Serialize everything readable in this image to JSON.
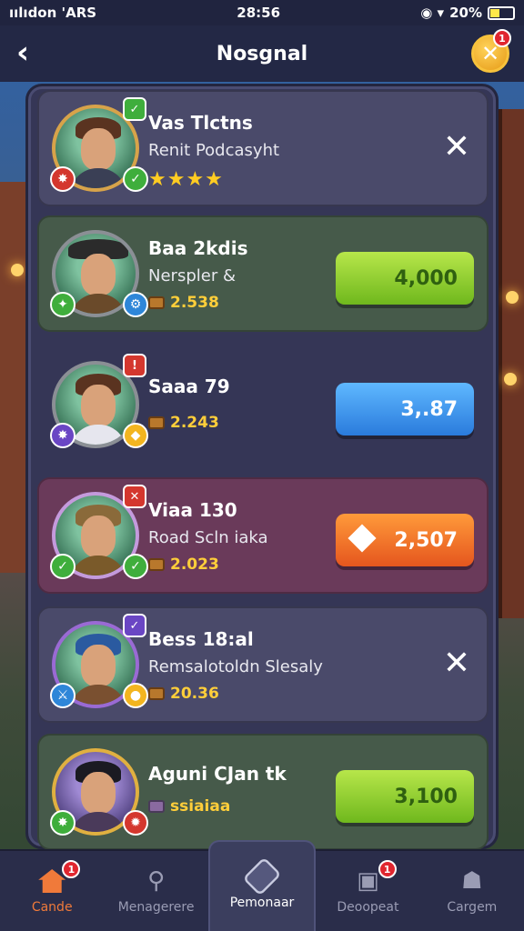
{
  "status_bar": {
    "carrier": "ıılıdon 'ARS",
    "time": "28:56",
    "battery": "20%"
  },
  "header": {
    "title": "Nosgnal",
    "back_glyph": "‹",
    "close_glyph": "✕",
    "close_badge": "1"
  },
  "cards": [
    {
      "name": "Vas Tlctns",
      "subtitle": "Renit Podcasyht",
      "stars": "★★★★",
      "action_type": "dismiss",
      "dismiss_glyph": "✕",
      "style": "gray"
    },
    {
      "name": "Baa 2kdis",
      "subtitle": "Nerspler &",
      "score": "2.538",
      "action_label": "4,000",
      "action_color": "green",
      "style": "green"
    },
    {
      "name": "Saaa 79",
      "subtitle": "",
      "score": "2.243",
      "action_label": "3,.87",
      "action_color": "blue",
      "style": "plain"
    },
    {
      "name": "Viaa 130",
      "subtitle": "Road Scln iaka",
      "score": "2.023",
      "action_label": "2,507",
      "action_color": "orange",
      "style": "pink"
    },
    {
      "name": "Bess 18:al",
      "subtitle": "Remsalotoldn Slesaly",
      "score": "20.36",
      "action_type": "dismiss",
      "dismiss_glyph": "✕",
      "style": "gray"
    },
    {
      "name": "Aguni CJan tk",
      "subtitle": "",
      "score": "ssiaiaa",
      "action_label": "3,100",
      "action_color": "green",
      "style": "green"
    }
  ],
  "nav": {
    "items": [
      {
        "label": "Cande",
        "badge": "1",
        "icon": "home-icon"
      },
      {
        "label": "Menagerere",
        "badge": "",
        "icon": "search-icon"
      },
      {
        "label": "Pemonaar",
        "badge": "",
        "icon": "box-icon"
      },
      {
        "label": "Deoopeat",
        "badge": "1",
        "icon": "card-icon"
      },
      {
        "label": "Cargem",
        "badge": "",
        "icon": "profile-icon"
      }
    ]
  },
  "colors": {
    "accent_green": "#8bd02a",
    "accent_blue": "#3b8ff0",
    "accent_orange": "#f3742a",
    "gold": "#ffce3a"
  }
}
